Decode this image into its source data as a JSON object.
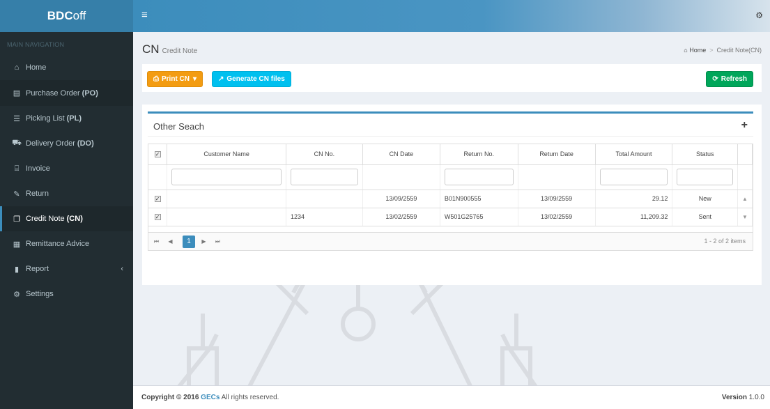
{
  "brand": {
    "bold": "BDC",
    "rest": "off"
  },
  "nav": {
    "header": "MAIN NAVIGATION",
    "items": [
      {
        "icon": "home-icon",
        "label": "Home",
        "bold": ""
      },
      {
        "icon": "file-icon",
        "label": "Purchase Order ",
        "bold": "(PO)"
      },
      {
        "icon": "list-icon",
        "label": "Picking List ",
        "bold": "(PL)"
      },
      {
        "icon": "truck-icon",
        "label": "Delivery Order ",
        "bold": "(DO)"
      },
      {
        "icon": "bank-icon",
        "label": "Invoice",
        "bold": ""
      },
      {
        "icon": "edit-icon",
        "label": "Return",
        "bold": ""
      },
      {
        "icon": "copy-icon",
        "label": "Credit Note ",
        "bold": "(CN)"
      },
      {
        "icon": "calendar-icon",
        "label": "Remittance Advice",
        "bold": ""
      },
      {
        "icon": "chart-icon",
        "label": "Report",
        "bold": ""
      },
      {
        "icon": "cogs-icon",
        "label": "Settings",
        "bold": ""
      }
    ]
  },
  "page": {
    "title": "CN",
    "subtitle": "Credit Note"
  },
  "breadcrumb": {
    "home": "Home",
    "sep": ">",
    "current": "Credit Note(CN)"
  },
  "toolbar": {
    "print": "Print CN",
    "generate": "Generate CN files",
    "refresh": "Refresh"
  },
  "search": {
    "title": "Other Seach",
    "toggle": "+"
  },
  "table": {
    "columns": [
      "Customer Name",
      "CN No.",
      "CN Date",
      "Return No.",
      "Return Date",
      "Total Amount",
      "Status"
    ],
    "rows": [
      {
        "customer": "",
        "cn_no": "",
        "cn_date": "13/09/2559",
        "return_no": "B01N900555",
        "return_date": "13/09/2559",
        "total": "29.12",
        "status": "New"
      },
      {
        "customer": "",
        "cn_no": "1234",
        "cn_date": "13/02/2559",
        "return_no": "W501G25765",
        "return_date": "13/02/2559",
        "total": "11,209.32",
        "status": "Sent"
      }
    ]
  },
  "pager": {
    "page": "1",
    "info": "1 - 2 of 2 items"
  },
  "footer": {
    "copyright": "Copyright © 2016 ",
    "company": "GECs",
    "rights": " All rights reserved.",
    "version_label": "Version",
    "version": "1.0.0"
  }
}
